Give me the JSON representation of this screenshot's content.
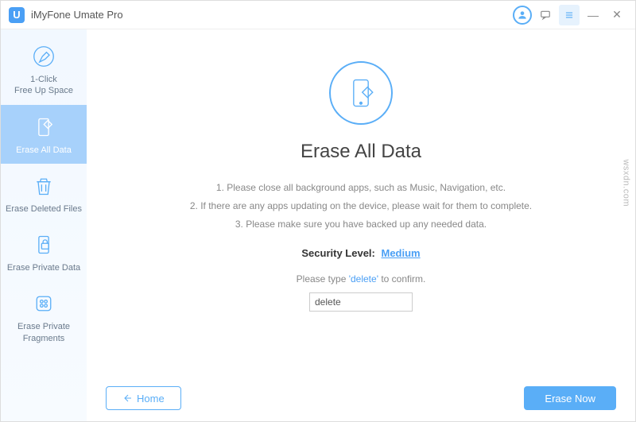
{
  "app": {
    "title": "iMyFone Umate Pro",
    "logo_letter": "U"
  },
  "sidebar": {
    "items": [
      {
        "label": "1-Click\nFree Up Space"
      },
      {
        "label": "Erase All Data"
      },
      {
        "label": "Erase Deleted Files"
      },
      {
        "label": "Erase Private Data"
      },
      {
        "label": "Erase Private\nFragments"
      }
    ]
  },
  "main": {
    "heading": "Erase All Data",
    "instructions": [
      "1. Please close all background apps, such as Music, Navigation, etc.",
      "2. If there are any apps updating on the device, please wait for them to complete.",
      "3. Please make sure you have backed up any needed data."
    ],
    "security_label": "Security Level:",
    "security_value": "Medium",
    "confirm_prefix": "Please type ",
    "confirm_word": "'delete'",
    "confirm_suffix": " to confirm.",
    "confirm_input_value": "delete"
  },
  "footer": {
    "home_label": "Home",
    "erase_label": "Erase Now"
  },
  "watermark": "wsxdn.com"
}
